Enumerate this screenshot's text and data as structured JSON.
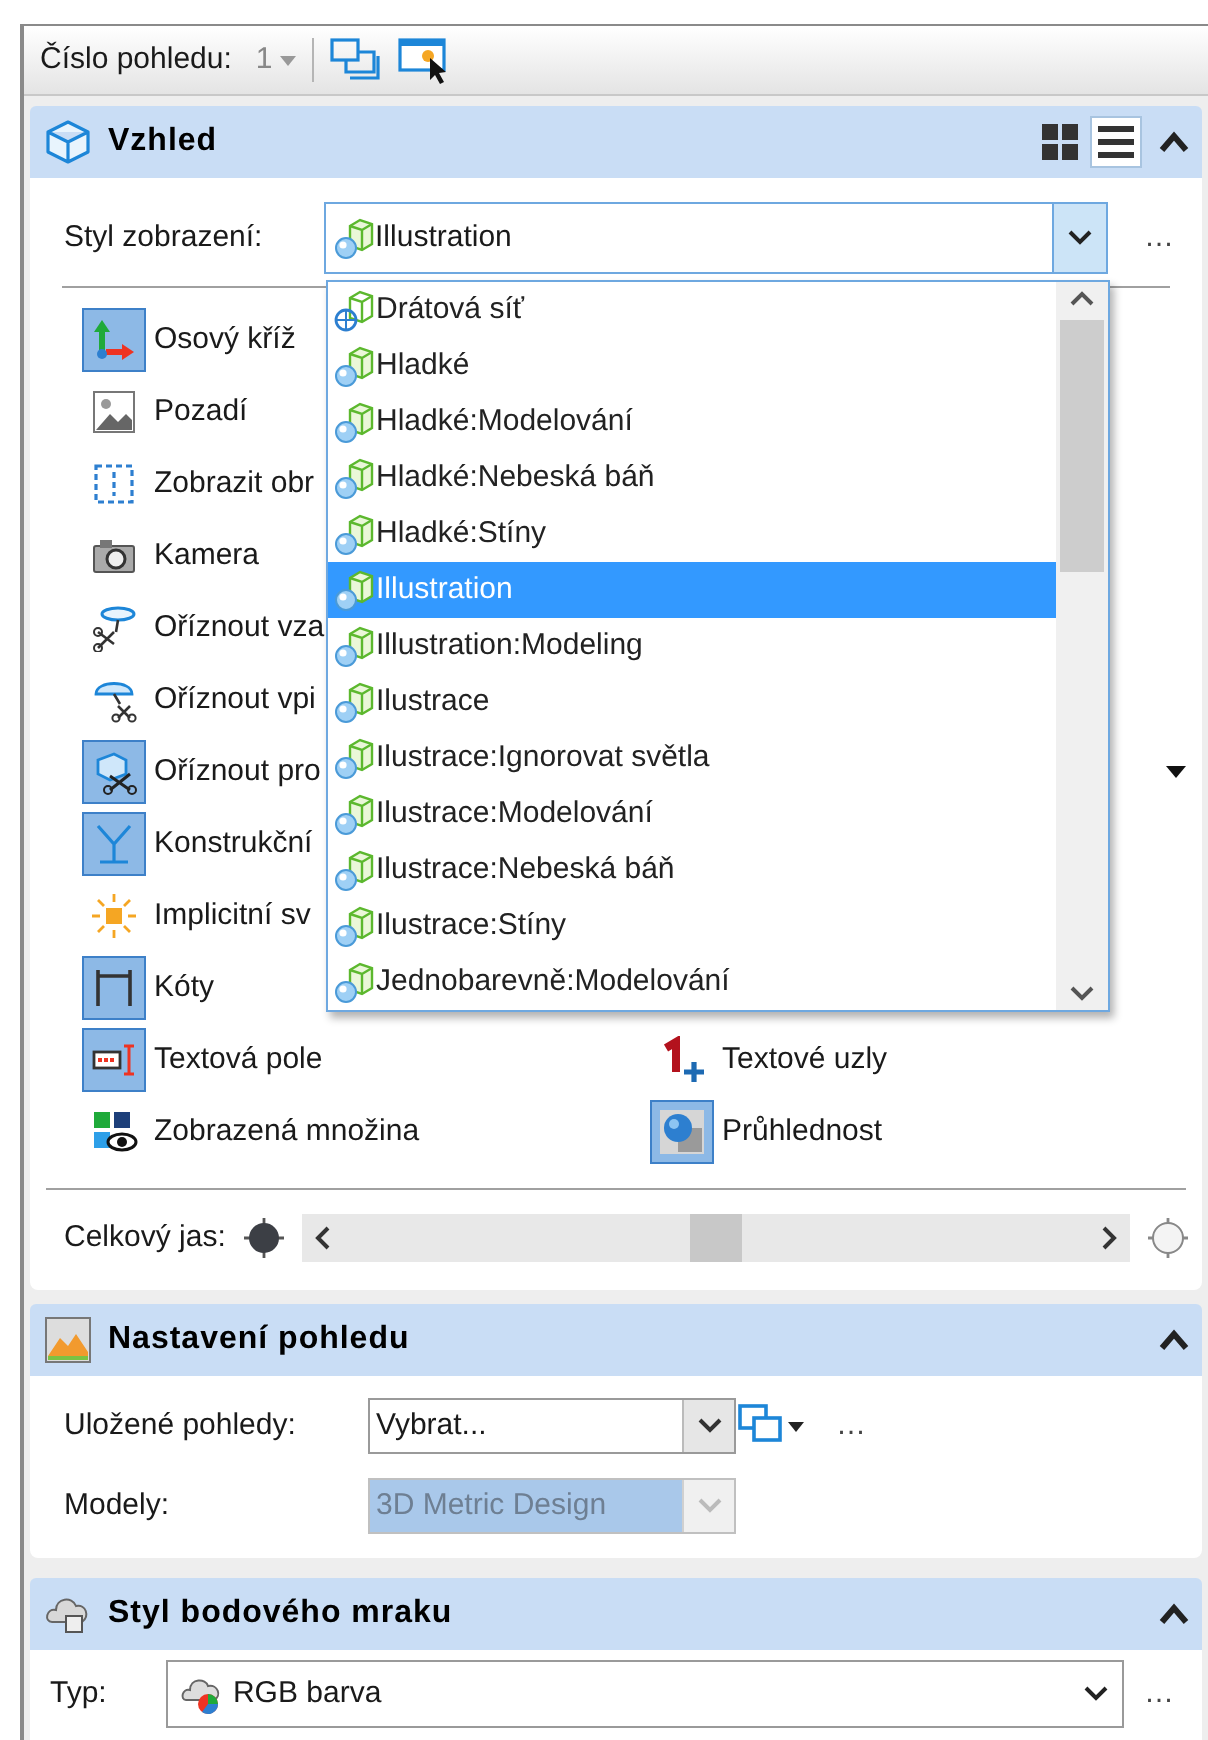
{
  "toolbar": {
    "label": "Číslo pohledu:",
    "value": "1"
  },
  "appearance": {
    "title": "Vzhled",
    "layout_buttons": [
      {
        "kind": "grid",
        "selected": false
      },
      {
        "kind": "list",
        "selected": true
      }
    ],
    "style_label": "Styl zobrazení:",
    "style_value": "Illustration",
    "style_more": "…",
    "style_open": true,
    "style_options": [
      {
        "label": "Drátová síť",
        "kind": "wireframe",
        "selected": false
      },
      {
        "label": "Hladké",
        "kind": "shaded",
        "selected": false
      },
      {
        "label": "Hladké:Modelování",
        "kind": "shaded",
        "selected": false
      },
      {
        "label": "Hladké:Nebeská báň",
        "kind": "shaded",
        "selected": false
      },
      {
        "label": "Hladké:Stíny",
        "kind": "shaded",
        "selected": false
      },
      {
        "label": "Illustration",
        "kind": "shaded",
        "selected": true
      },
      {
        "label": "Illustration:Modeling",
        "kind": "shaded",
        "selected": false
      },
      {
        "label": "Ilustrace",
        "kind": "shaded",
        "selected": false
      },
      {
        "label": "Ilustrace:Ignorovat světla",
        "kind": "shaded",
        "selected": false
      },
      {
        "label": "Ilustrace:Modelování",
        "kind": "shaded",
        "selected": false
      },
      {
        "label": "Ilustrace:Nebeská báň",
        "kind": "shaded",
        "selected": false
      },
      {
        "label": "Ilustrace:Stíny",
        "kind": "shaded",
        "selected": false
      },
      {
        "label": "Jednobarevně:Modelování",
        "kind": "shaded",
        "selected": false
      }
    ],
    "tools": [
      {
        "label": "Osový kříž",
        "on": true
      },
      {
        "label": "Pozadí",
        "on": false
      },
      {
        "label": "Zobrazit obr",
        "on": false
      },
      {
        "label": "Kamera",
        "on": false
      },
      {
        "label": "Oříznout vza",
        "on": false
      },
      {
        "label": "Oříznout vpi",
        "on": false
      },
      {
        "label": "Oříznout pro",
        "on": true
      },
      {
        "label": "Konstrukční",
        "on": true
      },
      {
        "label": "Implicitní sv",
        "on": false
      },
      {
        "label": "Kóty",
        "on": true
      },
      {
        "label": "Textová pole",
        "on": true
      },
      {
        "label": "Zobrazená množina",
        "on": false
      }
    ],
    "right_tools": [
      {
        "label": "Textové uzly",
        "on": false
      },
      {
        "label": "Průhlednost",
        "on": true
      }
    ],
    "brightness_label": "Celkový jas:",
    "brightness": {
      "level": 0.5
    }
  },
  "view_settings": {
    "title": "Nastavení pohledu",
    "saved_label": "Uložené pohledy:",
    "saved_value": "Vybrat...",
    "saved_more": "…",
    "models_label": "Modely:",
    "models_value": "3D Metric Design",
    "models_disabled": true
  },
  "point_cloud": {
    "title": "Styl bodového mraku",
    "type_label": "Typ:",
    "type_value": "RGB barva",
    "type_more": "…"
  }
}
